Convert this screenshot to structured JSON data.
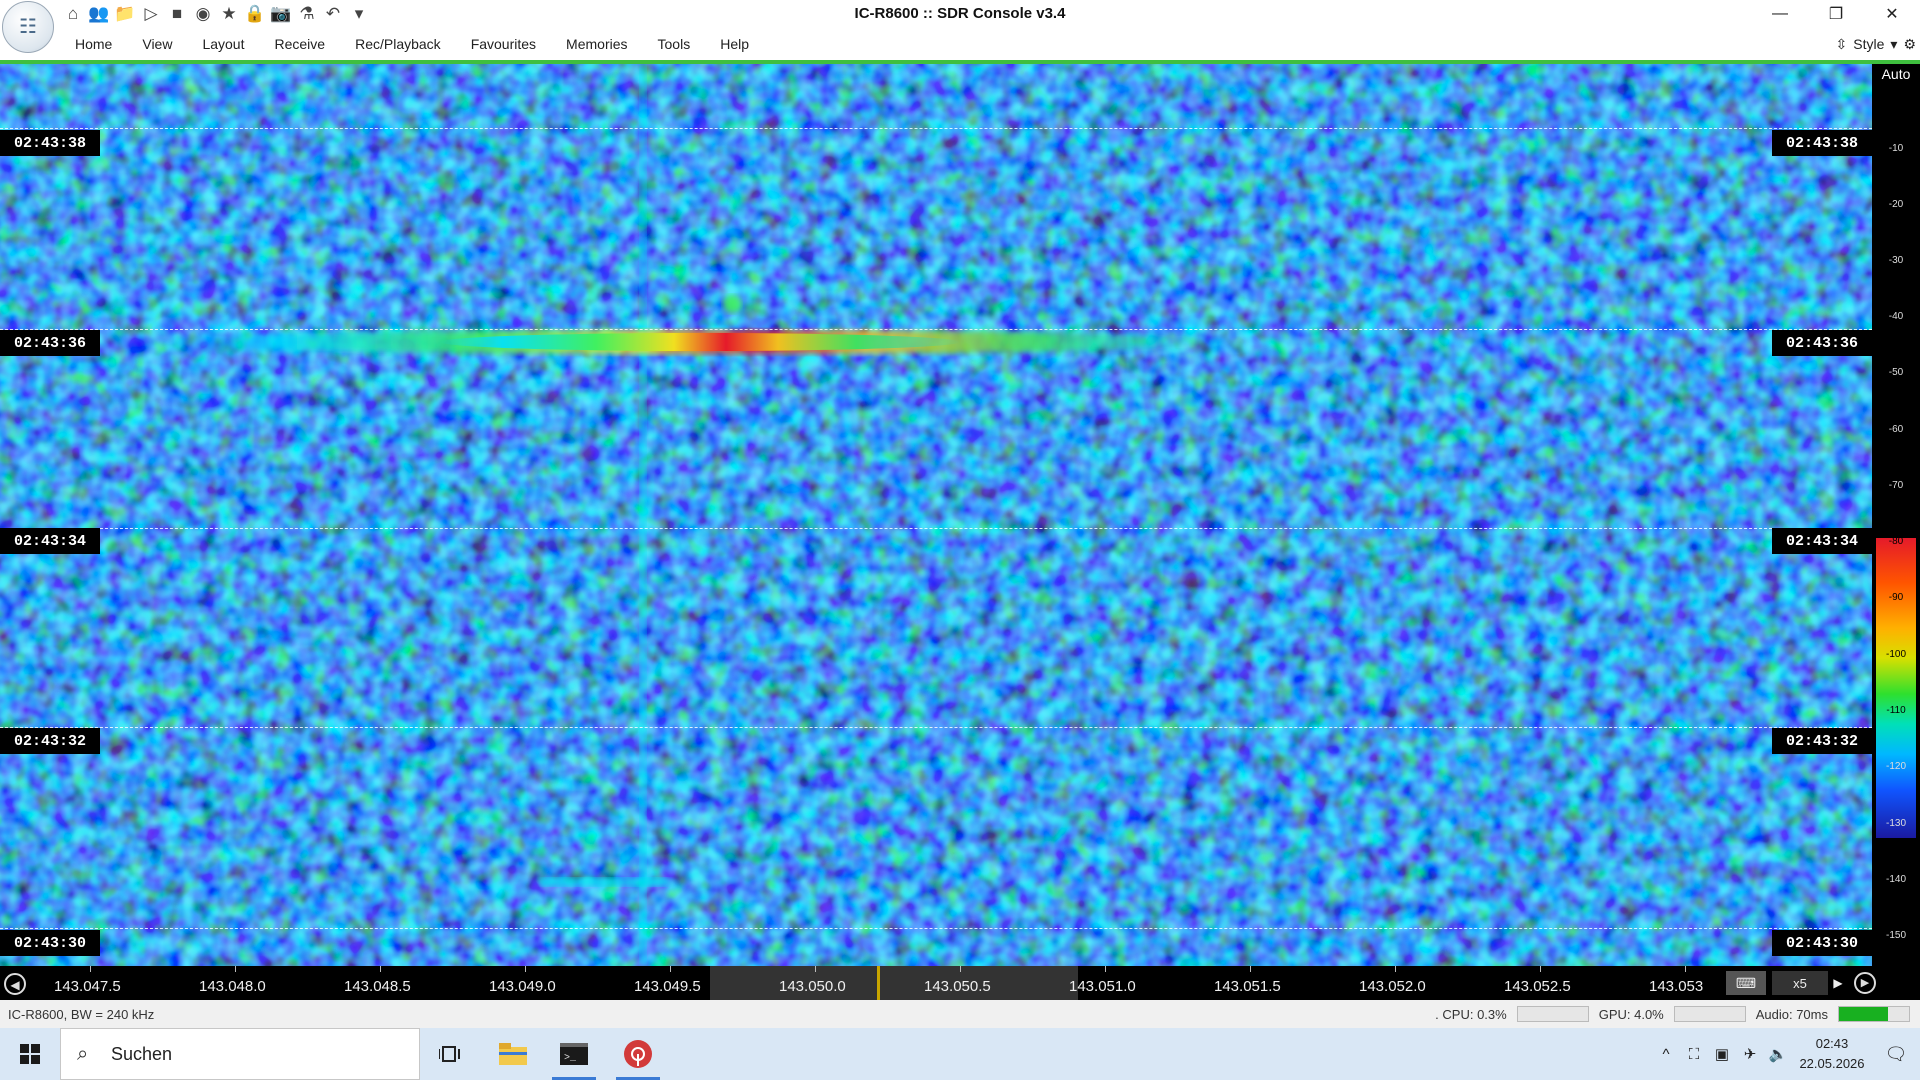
{
  "window": {
    "title": "IC-R8600 :: SDR Console v3.4",
    "controls": [
      "—",
      "❐",
      "✕"
    ]
  },
  "quick_access": [
    {
      "icon": "home-icon",
      "glyph": "⌂"
    },
    {
      "icon": "users-icon",
      "glyph": "👥"
    },
    {
      "icon": "folder-icon",
      "glyph": "📁"
    },
    {
      "icon": "play-icon",
      "glyph": "▷"
    },
    {
      "icon": "stop-icon",
      "glyph": "■"
    },
    {
      "icon": "globe-icon",
      "glyph": "◉"
    },
    {
      "icon": "star-icon",
      "glyph": "★"
    },
    {
      "icon": "lock-icon",
      "glyph": "🔒"
    },
    {
      "icon": "camera-icon",
      "glyph": "📷"
    },
    {
      "icon": "flask-icon",
      "glyph": "⚗"
    },
    {
      "icon": "undo-icon",
      "glyph": "↶"
    },
    {
      "icon": "dropdown-icon",
      "glyph": "▾"
    }
  ],
  "menu": [
    "Home",
    "View",
    "Layout",
    "Receive",
    "Rec/Playback",
    "Favourites",
    "Memories",
    "Tools",
    "Help"
  ],
  "style_menu": {
    "label": "Style"
  },
  "waterfall": {
    "timestamps": [
      "02:43:38",
      "02:43:36",
      "02:43:34",
      "02:43:32",
      "02:43:30"
    ]
  },
  "color_scale": {
    "auto_label": "Auto",
    "ticks": [
      "-10",
      "-20",
      "-30",
      "-40",
      "-50",
      "-60",
      "-70",
      "-80",
      "-90",
      "-100",
      "-110",
      "-120",
      "-130",
      "-140",
      "-150"
    ],
    "colors": {
      "noise_bg": "#0a1a9a",
      "signal_peak": "#e51a2a",
      "tuning_marker": "#c9a600"
    }
  },
  "frequency_axis": {
    "labels": [
      "143.047.5",
      "143.048.0",
      "143.048.5",
      "143.049.0",
      "143.049.5",
      "143.050.0",
      "143.050.5",
      "143.051.0",
      "143.051.5",
      "143.052.0",
      "143.052.5",
      "143.053"
    ],
    "zoom": "x5",
    "zoom_arrow": "▶",
    "left_control": "◀",
    "right_control": "▶"
  },
  "status": {
    "device": "IC-R8600, BW = 240 kHz",
    "cpu": ". CPU: 0.3%",
    "gpu": "GPU: 4.0%",
    "audio": "Audio: 70ms"
  },
  "taskbar": {
    "search_placeholder": "Suchen",
    "time": "02:43",
    "date": "22.05.2026"
  }
}
